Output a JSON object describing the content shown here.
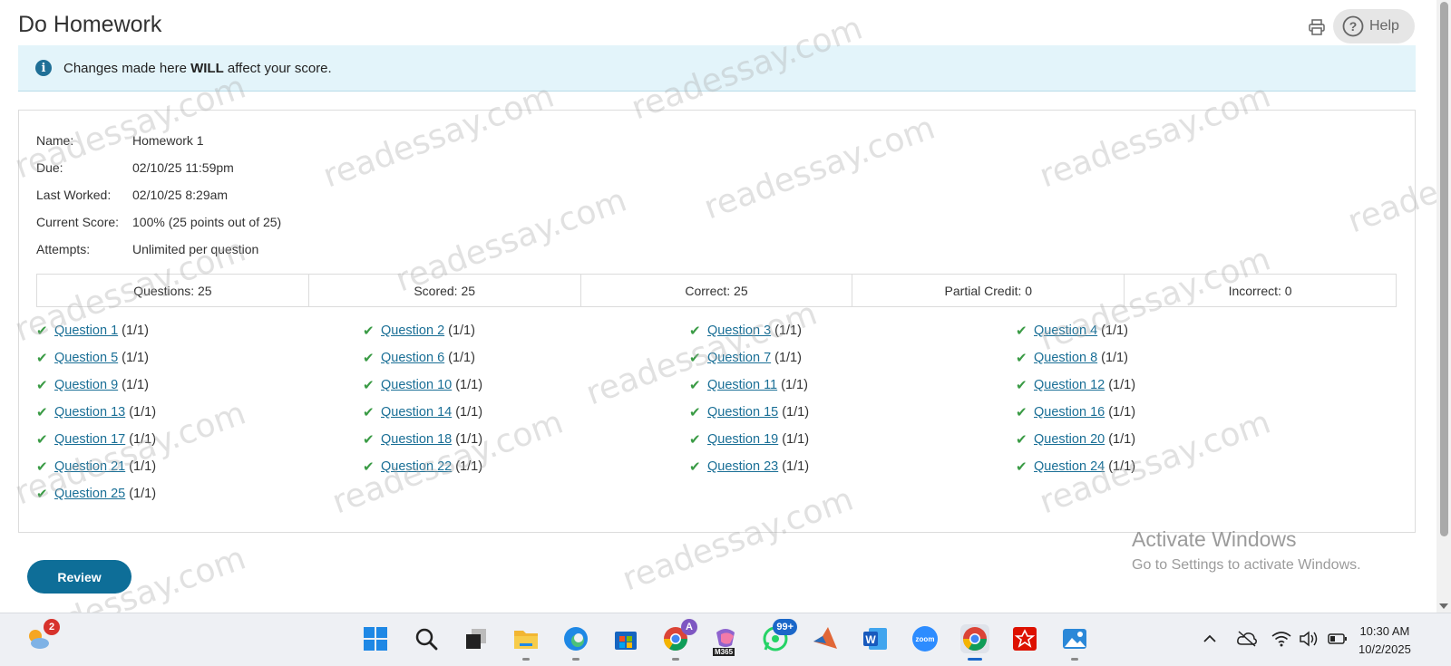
{
  "header": {
    "title": "Do Homework",
    "help_label": "Help"
  },
  "banner": {
    "text_before": "Changes made here ",
    "text_bold": "WILL",
    "text_after": " affect your score."
  },
  "info": {
    "name_label": "Name:",
    "name_value": "Homework 1",
    "due_label": "Due:",
    "due_value": "02/10/25 11:59pm",
    "last_worked_label": "Last Worked:",
    "last_worked_value": "02/10/25 8:29am",
    "score_label": "Current Score:",
    "score_value": "100% (25 points out of 25)",
    "attempts_label": "Attempts:",
    "attempts_value": "Unlimited per question"
  },
  "summary": {
    "questions": "Questions: 25",
    "scored": "Scored: 25",
    "correct": "Correct: 25",
    "partial": "Partial Credit: 0",
    "incorrect": "Incorrect: 0"
  },
  "questions": [
    {
      "label": "Question 1",
      "score": "(1/1)"
    },
    {
      "label": "Question 2",
      "score": "(1/1)"
    },
    {
      "label": "Question 3",
      "score": "(1/1)"
    },
    {
      "label": "Question 4",
      "score": "(1/1)"
    },
    {
      "label": "Question 5",
      "score": "(1/1)"
    },
    {
      "label": "Question 6",
      "score": "(1/1)"
    },
    {
      "label": "Question 7",
      "score": "(1/1)"
    },
    {
      "label": "Question 8",
      "score": "(1/1)"
    },
    {
      "label": "Question 9",
      "score": "(1/1)"
    },
    {
      "label": "Question 10",
      "score": "(1/1)"
    },
    {
      "label": "Question 11",
      "score": "(1/1)"
    },
    {
      "label": "Question 12",
      "score": "(1/1)"
    },
    {
      "label": "Question 13",
      "score": "(1/1)"
    },
    {
      "label": "Question 14",
      "score": "(1/1)"
    },
    {
      "label": "Question 15",
      "score": "(1/1)"
    },
    {
      "label": "Question 16",
      "score": "(1/1)"
    },
    {
      "label": "Question 17",
      "score": "(1/1)"
    },
    {
      "label": "Question 18",
      "score": "(1/1)"
    },
    {
      "label": "Question 19",
      "score": "(1/1)"
    },
    {
      "label": "Question 20",
      "score": "(1/1)"
    },
    {
      "label": "Question 21",
      "score": "(1/1)"
    },
    {
      "label": "Question 22",
      "score": "(1/1)"
    },
    {
      "label": "Question 23",
      "score": "(1/1)"
    },
    {
      "label": "Question 24",
      "score": "(1/1)"
    },
    {
      "label": "Question 25",
      "score": "(1/1)"
    }
  ],
  "review_label": "Review",
  "activate_windows": {
    "title": "Activate Windows",
    "subtitle": "Go to Settings to activate Windows."
  },
  "watermark_text": "readessay.com",
  "taskbar": {
    "weather_badge": "2",
    "whatsapp_badge": "99+",
    "copilot_badge": "A",
    "m365_label": "M365",
    "zoom_label": "zoom",
    "time": "10:30 AM",
    "date": "10/2/2025"
  },
  "colors": {
    "accent": "#0e6e98",
    "link": "#1a6f96",
    "check": "#3a9b45",
    "banner_bg": "#e3f4fa"
  }
}
